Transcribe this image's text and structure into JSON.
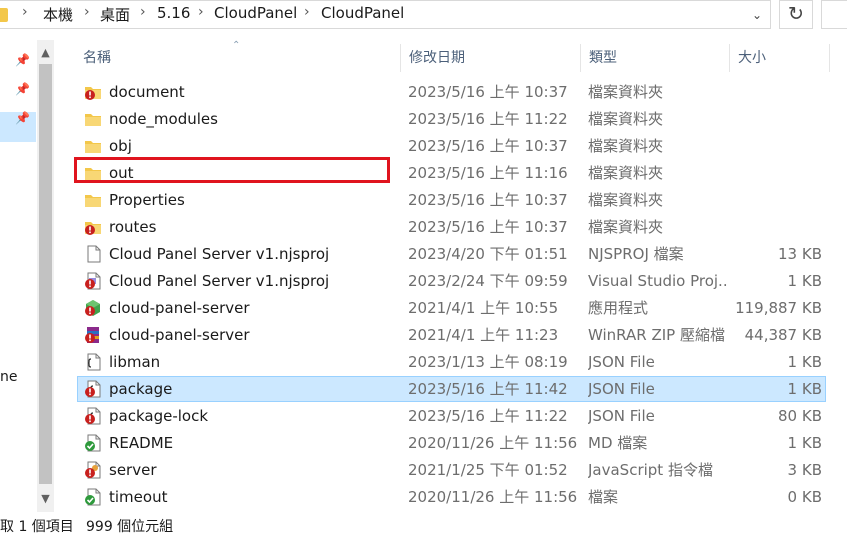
{
  "address": {
    "crumbs": [
      "本機",
      "桌面",
      "5.16",
      "CloudPanel",
      "CloudPanel"
    ],
    "separator": "›"
  },
  "nav": {
    "partial_label": "ne"
  },
  "header": {
    "name": "名稱",
    "date": "修改日期",
    "type": "類型",
    "size": "大小"
  },
  "files": [
    {
      "name": "document",
      "date": "2023/5/16 上午 10:37",
      "type": "檔案資料夾",
      "size": "",
      "icon": "folder-error-icon"
    },
    {
      "name": "node_modules",
      "date": "2023/5/16 上午 11:22",
      "type": "檔案資料夾",
      "size": "",
      "icon": "folder-icon"
    },
    {
      "name": "obj",
      "date": "2023/5/16 上午 10:37",
      "type": "檔案資料夾",
      "size": "",
      "icon": "folder-icon"
    },
    {
      "name": "out",
      "date": "2023/5/16 上午 11:16",
      "type": "檔案資料夾",
      "size": "",
      "icon": "folder-icon"
    },
    {
      "name": "Properties",
      "date": "2023/5/16 上午 10:37",
      "type": "檔案資料夾",
      "size": "",
      "icon": "folder-icon"
    },
    {
      "name": "routes",
      "date": "2023/5/16 上午 10:37",
      "type": "檔案資料夾",
      "size": "",
      "icon": "folder-error-icon"
    },
    {
      "name": "Cloud Panel Server v1.njsproj",
      "date": "2023/4/20 下午 01:51",
      "type": "NJSPROJ 檔案",
      "size": "13 KB",
      "icon": "blank-file-icon"
    },
    {
      "name": "Cloud Panel Server v1.njsproj",
      "date": "2023/2/24 下午 09:59",
      "type": "Visual Studio Proj...",
      "size": "1 KB",
      "icon": "vs-project-icon"
    },
    {
      "name": "cloud-panel-server",
      "date": "2021/4/1 上午 10:55",
      "type": "應用程式",
      "size": "119,887 KB",
      "icon": "app-icon"
    },
    {
      "name": "cloud-panel-server",
      "date": "2021/4/1 上午 11:23",
      "type": "WinRAR ZIP 壓縮檔",
      "size": "44,387 KB",
      "icon": "winrar-icon"
    },
    {
      "name": "libman",
      "date": "2023/1/13 上午 08:19",
      "type": "JSON File",
      "size": "1 KB",
      "icon": "json-icon"
    },
    {
      "name": "package",
      "date": "2023/5/16 上午 11:42",
      "type": "JSON File",
      "size": "1 KB",
      "icon": "json-error-icon"
    },
    {
      "name": "package-lock",
      "date": "2023/5/16 上午 11:22",
      "type": "JSON File",
      "size": "80 KB",
      "icon": "json-error-icon"
    },
    {
      "name": "README",
      "date": "2020/11/26 上午 11:56",
      "type": "MD 檔案",
      "size": "1 KB",
      "icon": "md-check-icon"
    },
    {
      "name": "server",
      "date": "2021/1/25 下午 01:52",
      "type": "JavaScript 指令檔",
      "size": "3 KB",
      "icon": "js-error-icon"
    },
    {
      "name": "timeout",
      "date": "2020/11/26 上午 11:56",
      "type": "檔案",
      "size": "0 KB",
      "icon": "file-check-icon"
    }
  ],
  "selected_index": 11,
  "highlighted_index": 3,
  "status": {
    "selected": "取 1 個項目",
    "size": "999 個位元組"
  },
  "colors": {
    "selection": "#cce8ff",
    "highlight_box": "#e0141e",
    "folder": "#f3c74a"
  }
}
